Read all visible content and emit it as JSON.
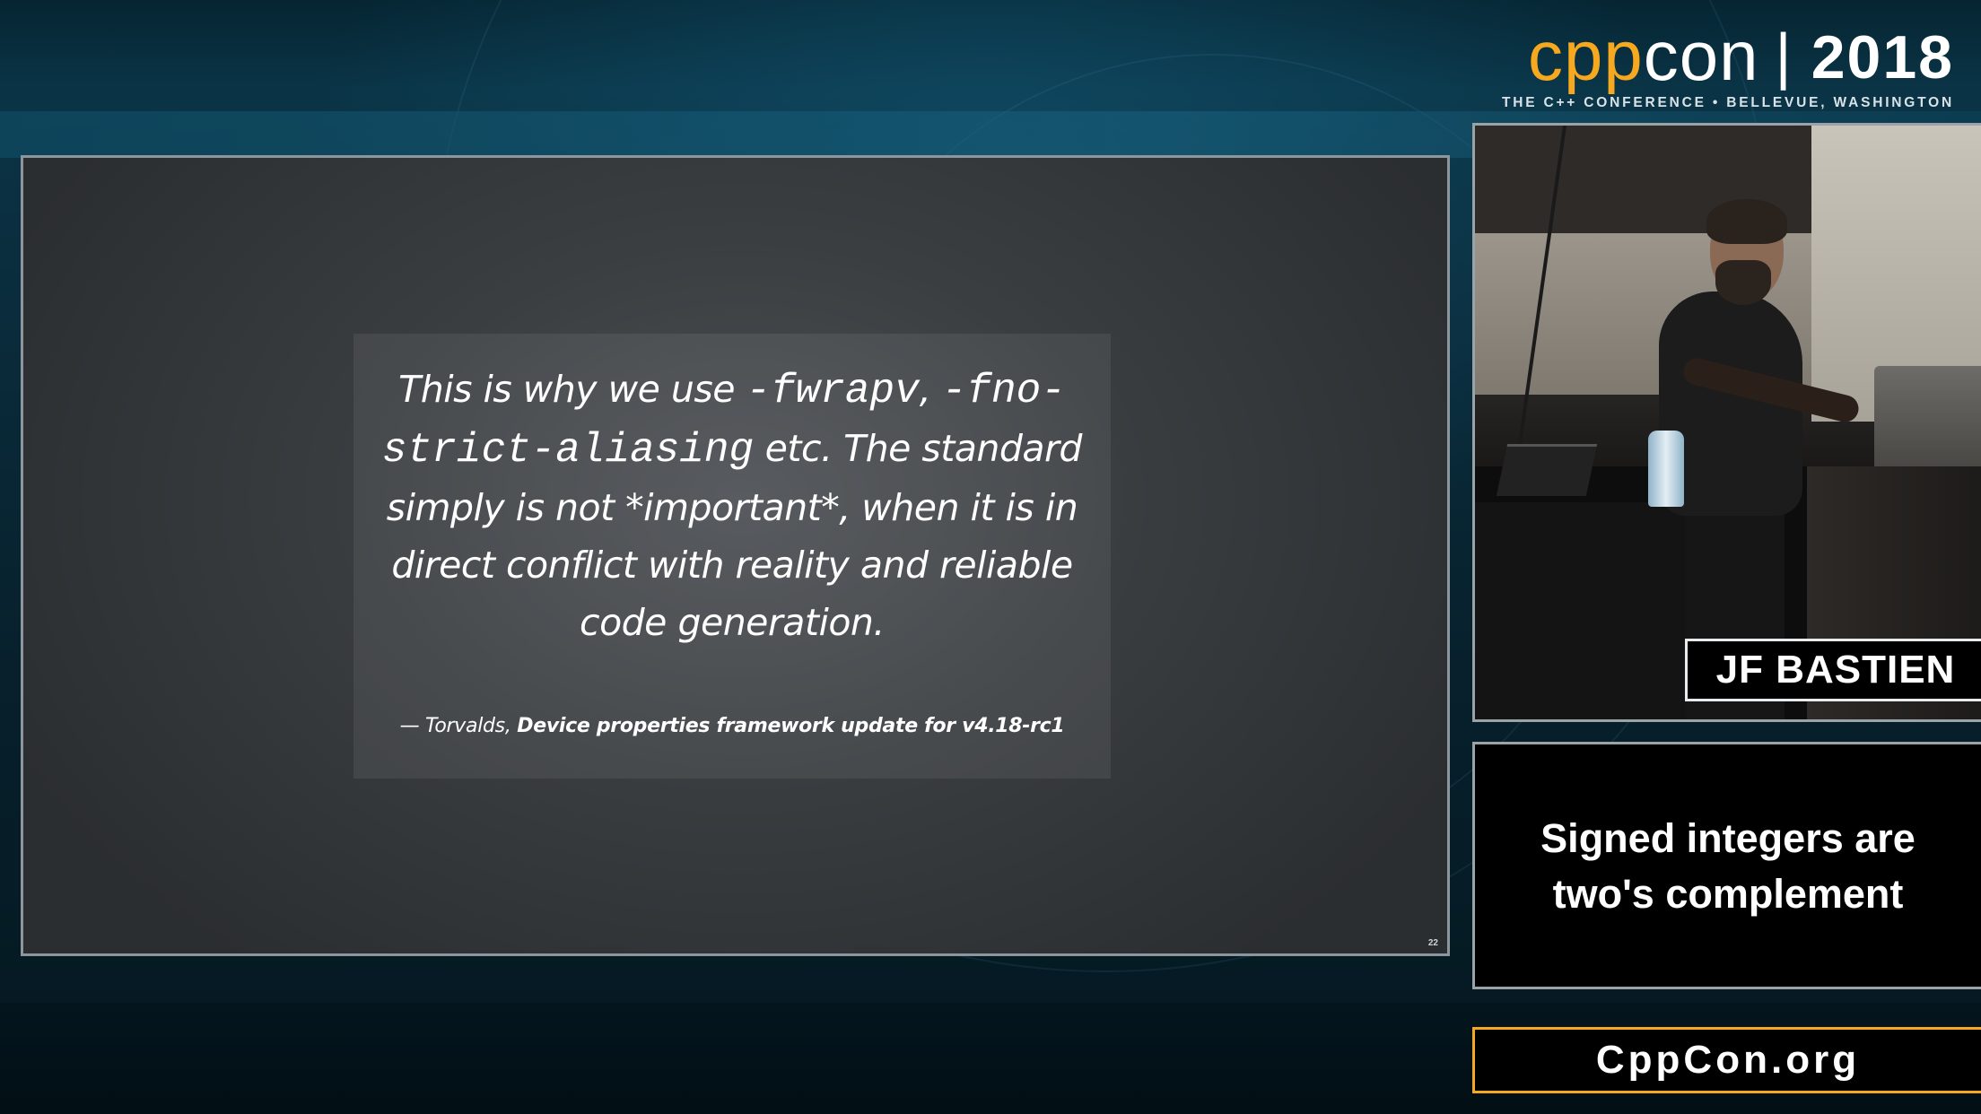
{
  "branding": {
    "logo_part1": "cpp",
    "logo_part2": "con",
    "separator": "|",
    "year": "2018",
    "subtitle": "THE C++ CONFERENCE • BELLEVUE, WASHINGTON",
    "accent_color": "#f6a81f"
  },
  "slide": {
    "quote_lines": [
      {
        "pre": "This is why we use ",
        "mono": "-fwrapv",
        "post": ", "
      },
      {
        "pre": "",
        "mono": "-fno-",
        "post": ""
      },
      {
        "pre": "",
        "mono": "strict-aliasing",
        "post": " etc. The standard"
      },
      {
        "pre": "simply is not *important*, when it is in",
        "mono": "",
        "post": ""
      },
      {
        "pre": "direct conflict with reality and reliable",
        "mono": "",
        "post": ""
      },
      {
        "pre": "code generation.",
        "mono": "",
        "post": ""
      }
    ],
    "attribution_prefix": "— Torvalds, ",
    "attribution_title": "Device properties framework update for v4.18-rc1",
    "slide_number": "22"
  },
  "speaker": {
    "name": "JF BASTIEN"
  },
  "caption": {
    "line1": "Signed integers are",
    "line2": "two's complement"
  },
  "footer": {
    "url": "CppCon.org"
  }
}
